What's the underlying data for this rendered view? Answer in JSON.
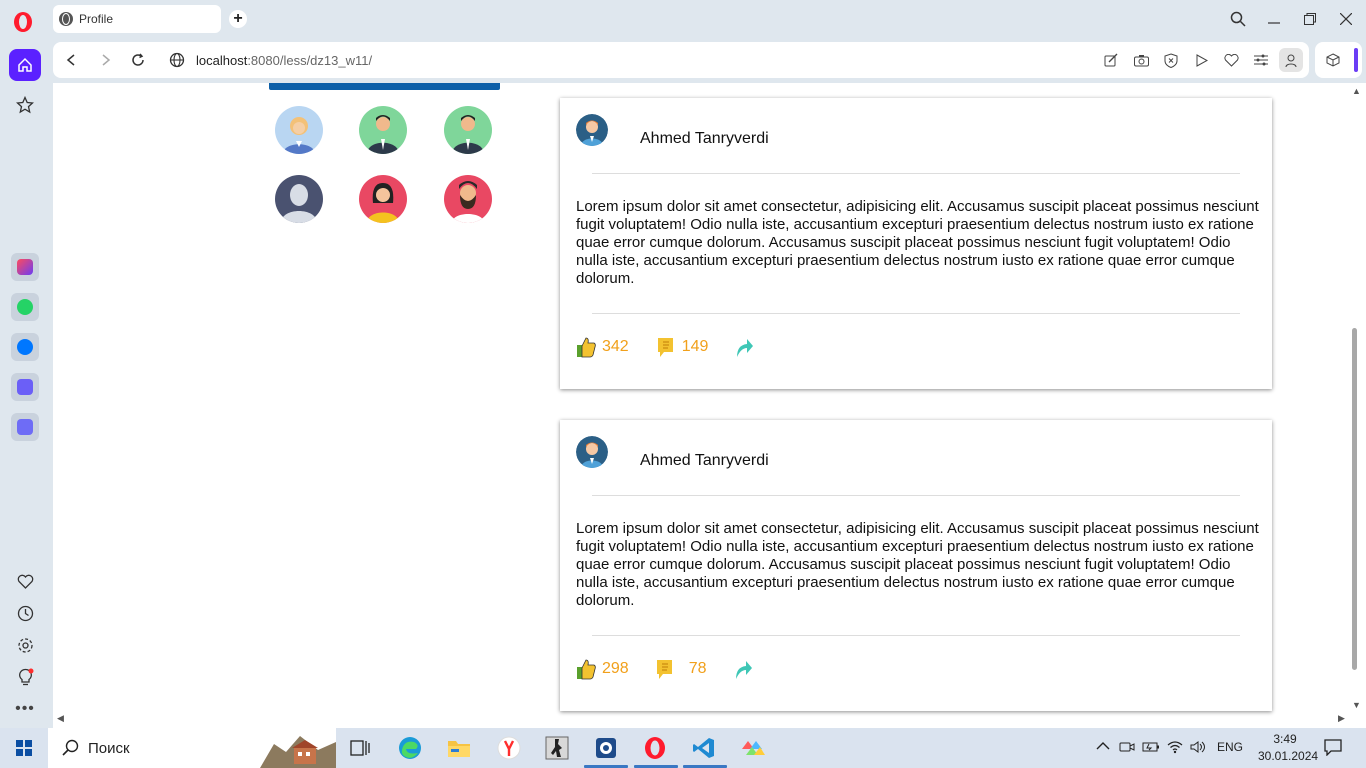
{
  "browser": {
    "tab_title": "Profile",
    "url_host": "localhost",
    "url_rest": ":8080/less/dz13_w11/"
  },
  "sidebar": {
    "icons": [
      "home-icon",
      "star-icon",
      "aria-icon",
      "whatsapp-icon",
      "vk-icon",
      "music-icon",
      "player-icon",
      "heart-icon",
      "history-icon",
      "settings-icon",
      "lightbulb-icon",
      "more-icon"
    ]
  },
  "friends": {
    "avatars": [
      "woman-blonde",
      "man-suit",
      "man-suit",
      "silhouette",
      "woman-dark",
      "man-beard"
    ]
  },
  "posts": [
    {
      "author": "Ahmed Tanryverdi",
      "text": "Lorem ipsum dolor sit amet consectetur, adipisicing elit. Accusamus suscipit placeat possimus nesciunt fugit voluptatem! Odio nulla iste, accusantium excepturi praesentium delectus nostrum iusto ex ratione quae error cumque dolorum. Accusamus suscipit placeat possimus nesciunt fugit voluptatem! Odio nulla iste, accusantium excepturi praesentium delectus nostrum iusto ex ratione quae error cumque dolorum.",
      "likes": "342",
      "comments": "149"
    },
    {
      "author": "Ahmed Tanryverdi",
      "text": "Lorem ipsum dolor sit amet consectetur, adipisicing elit. Accusamus suscipit placeat possimus nesciunt fugit voluptatem! Odio nulla iste, accusantium excepturi praesentium delectus nostrum iusto ex ratione quae error cumque dolorum. Accusamus suscipit placeat possimus nesciunt fugit voluptatem! Odio nulla iste, accusantium excepturi praesentium delectus nostrum iusto ex ratione quae error cumque dolorum.",
      "likes": "298",
      "comments": "78"
    }
  ],
  "taskbar": {
    "search_placeholder": "Поиск",
    "language": "ENG",
    "time": "3:49",
    "date": "30.01.2024"
  },
  "colors": {
    "accent": "#5b21ff",
    "count": "#f1a01b",
    "blue_strip": "#0d5fa8"
  }
}
